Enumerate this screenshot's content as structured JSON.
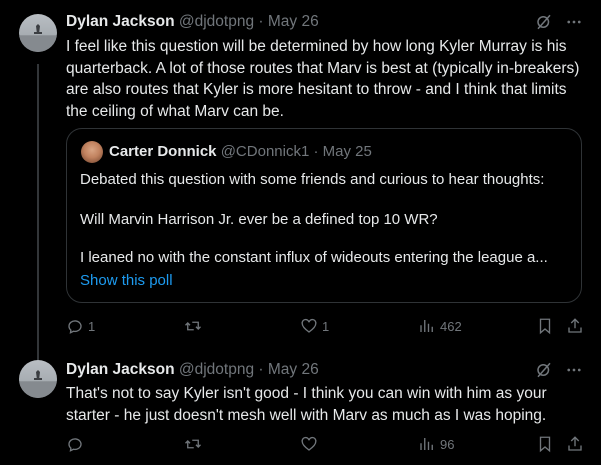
{
  "tweets": [
    {
      "name": "Dylan Jackson",
      "handle": "@djdotpng",
      "separator": "·",
      "date": "May 26",
      "text": "I feel like this question will be determined by how long Kyler Murray is his quarterback. A lot of those routes that Marv is best at (typically in-breakers) are also routes that Kyler is more hesitant to throw - and I think that limits the ceiling of what Marv can be.",
      "quote": {
        "name": "Carter Donnick",
        "handle": "@CDonnick1",
        "separator": "·",
        "date": "May 25",
        "line1": "Debated this question with some friends and curious to hear thoughts:",
        "line2": "Will Marvin Harrison Jr. ever be a defined top 10 WR?",
        "line3": "I leaned no with the constant influx of wideouts entering the league a...",
        "link": "Show this poll"
      },
      "actions": {
        "replies": "1",
        "retweets": "",
        "likes": "1",
        "views": "462"
      }
    },
    {
      "name": "Dylan Jackson",
      "handle": "@djdotpng",
      "separator": "·",
      "date": "May 26",
      "text": "That's not to say Kyler isn't good - I think you can win with him as your starter - he just doesn't mesh well with Marv as much as I was hoping.",
      "actions": {
        "replies": "",
        "retweets": "",
        "likes": "",
        "views": "96"
      }
    }
  ],
  "icons": [
    "grok-icon",
    "more-icon",
    "reply-icon",
    "retweet-icon",
    "like-icon",
    "views-icon",
    "bookmark-icon",
    "share-icon"
  ],
  "colors": {
    "background": "#000000",
    "text": "#e7e9ea",
    "muted": "#71767b",
    "link": "#1d9bf0",
    "border": "#2f3336"
  }
}
